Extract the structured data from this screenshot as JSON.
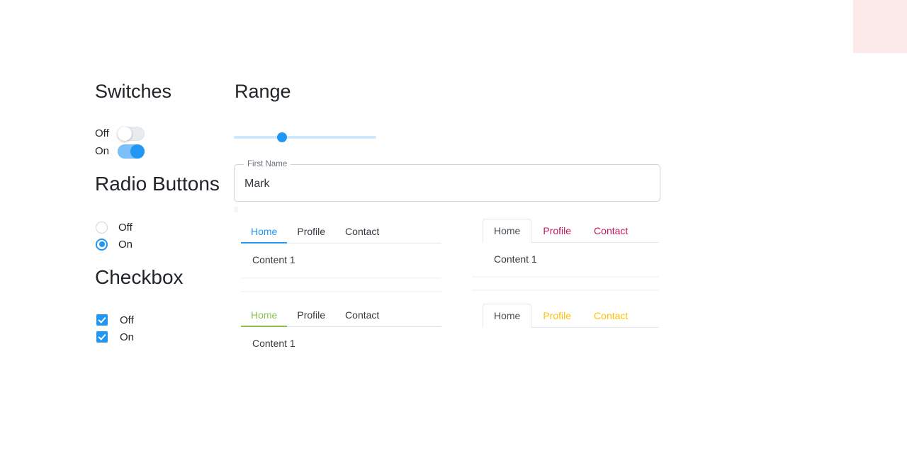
{
  "decor": {
    "pink_block_color": "#fceaea"
  },
  "colors": {
    "accent_blue": "#2196f3",
    "accent_green": "#8bc34a",
    "accent_crimson": "#c2185b",
    "accent_amber": "#ffc107",
    "track_light_blue": "#cfe8fb",
    "border_gray": "#ced4da"
  },
  "switches": {
    "heading": "Switches",
    "items": [
      {
        "label": "Off",
        "checked": false
      },
      {
        "label": "On",
        "checked": true
      }
    ]
  },
  "radio": {
    "heading": "Radio Buttons",
    "items": [
      {
        "label": "Off",
        "checked": false
      },
      {
        "label": "On",
        "checked": true
      }
    ]
  },
  "checkbox": {
    "heading": "Checkbox",
    "items": [
      {
        "label": "Off",
        "checked": true
      },
      {
        "label": "On",
        "checked": true
      }
    ]
  },
  "range": {
    "heading": "Range",
    "value_percent": 34
  },
  "text_field": {
    "label": "First Name",
    "value": "Mark",
    "placeholder": "First Name"
  },
  "tabs": {
    "set1": {
      "style": "underline-blue",
      "items": [
        {
          "label": "Home",
          "active": true
        },
        {
          "label": "Profile",
          "active": false
        },
        {
          "label": "Contact",
          "active": false
        }
      ],
      "content": "Content 1"
    },
    "set2": {
      "style": "boxed-crimson",
      "items": [
        {
          "label": "Home",
          "active": true
        },
        {
          "label": "Profile",
          "active": false
        },
        {
          "label": "Contact",
          "active": false
        }
      ],
      "content": "Content 1"
    },
    "set3": {
      "style": "underline-green",
      "items": [
        {
          "label": "Home",
          "active": true
        },
        {
          "label": "Profile",
          "active": false
        },
        {
          "label": "Contact",
          "active": false
        }
      ],
      "content": "Content 1"
    },
    "set4": {
      "style": "boxed-amber",
      "items": [
        {
          "label": "Home",
          "active": true
        },
        {
          "label": "Profile",
          "active": false
        },
        {
          "label": "Contact",
          "active": false
        }
      ],
      "content": ""
    }
  }
}
